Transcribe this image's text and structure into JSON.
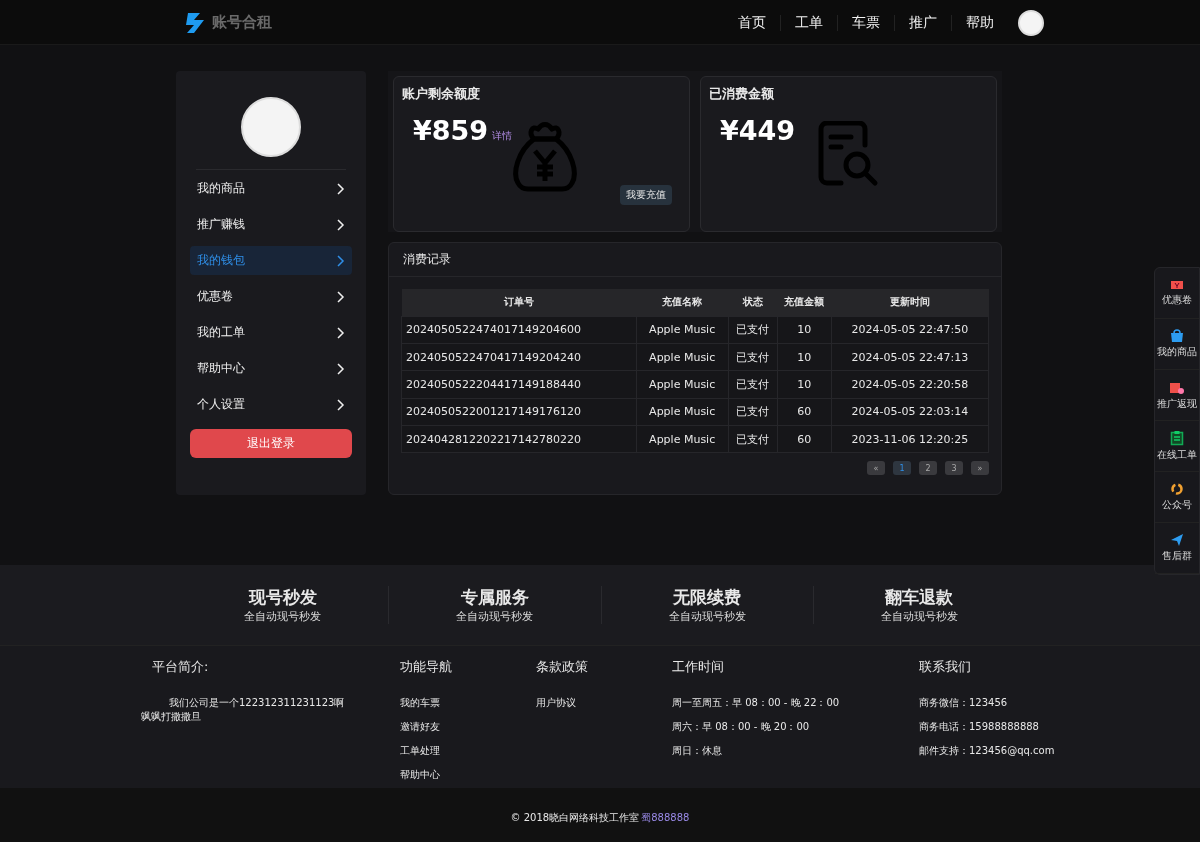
{
  "header": {
    "logo_text": "账号合租",
    "nav": [
      {
        "label": "首页"
      },
      {
        "label": "工单"
      },
      {
        "label": "车票"
      },
      {
        "label": "推广"
      },
      {
        "label": "帮助"
      }
    ]
  },
  "sidebar": {
    "items": [
      {
        "label": "我的商品",
        "selected": false
      },
      {
        "label": "推广赚钱",
        "selected": false
      },
      {
        "label": "我的钱包",
        "selected": true
      },
      {
        "label": "优惠卷",
        "selected": false
      },
      {
        "label": "我的工单",
        "selected": false
      },
      {
        "label": "帮助中心",
        "selected": false
      },
      {
        "label": "个人设置",
        "selected": false
      }
    ],
    "logout": "退出登录"
  },
  "cards": [
    {
      "kind": "balance",
      "title": "账户剩余额度",
      "amount": "¥859",
      "link": "详情",
      "button": "我要充值"
    },
    {
      "kind": "spent",
      "title": "已消费金额",
      "amount": "¥449"
    }
  ],
  "records": {
    "title": "消费记录",
    "columns": [
      "订单号",
      "充值名称",
      "状态",
      "充值金额",
      "更新时间"
    ],
    "rows": [
      [
        "2024050522474017149204600",
        "Apple Music",
        "已支付",
        "10",
        "2024-05-05 22:47:50"
      ],
      [
        "2024050522470417149204240",
        "Apple Music",
        "已支付",
        "10",
        "2024-05-05 22:47:13"
      ],
      [
        "2024050522204417149188440",
        "Apple Music",
        "已支付",
        "10",
        "2024-05-05 22:20:58"
      ],
      [
        "2024050522001217149176120",
        "Apple Music",
        "已支付",
        "60",
        "2024-05-05 22:03:14"
      ],
      [
        "2024042812202217142780220",
        "Apple Music",
        "已支付",
        "60",
        "2023-11-06 12:20:25"
      ]
    ],
    "pages": [
      {
        "label": "«",
        "selected": false
      },
      {
        "label": "1",
        "selected": true
      },
      {
        "label": "2",
        "selected": false
      },
      {
        "label": "3",
        "selected": false
      },
      {
        "label": "»",
        "selected": false
      }
    ]
  },
  "float_bar": [
    {
      "kind": "ticket",
      "label": "优惠卷"
    },
    {
      "kind": "bag",
      "label": "我的商品"
    },
    {
      "kind": "gift",
      "label": "推广返现"
    },
    {
      "kind": "clipboard",
      "label": "在线工单"
    },
    {
      "kind": "swirl",
      "label": "公众号"
    },
    {
      "kind": "plane",
      "label": "售后群"
    }
  ],
  "features": [
    {
      "title": "现号秒发",
      "subtitle": "全自动现号秒发"
    },
    {
      "title": "专属服务",
      "subtitle": "全自动现号秒发"
    },
    {
      "title": "无限续费",
      "subtitle": "全自动现号秒发"
    },
    {
      "title": "翻车退款",
      "subtitle": "全自动现号秒发"
    }
  ],
  "footer": {
    "about_title": "平台简介:",
    "about_text": "我们公司是一个122312311231123啊飒飒打撒撒旦",
    "columns": [
      {
        "title": "功能导航",
        "links": [
          "我的车票",
          "邀请好友",
          "工单处理",
          "帮助中心"
        ]
      },
      {
        "title": "条款政策",
        "links": [
          "用户协议"
        ]
      },
      {
        "title": "工作时间",
        "links": [
          "周一至周五：早 08：00 - 晚 22：00",
          "周六：早 08：00 - 晚 20：00",
          "周日：休息"
        ]
      },
      {
        "title": "联系我们",
        "links": [
          "商务微信：123456",
          "商务电话：15988888888",
          "邮件支持：123456@qq.com"
        ]
      }
    ],
    "copyright": "© 2018晓白网络科技工作室",
    "icp": "蜀888888"
  }
}
